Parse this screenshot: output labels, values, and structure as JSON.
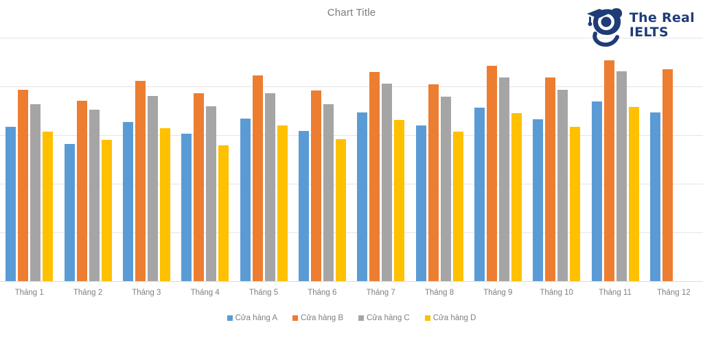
{
  "chart": {
    "title": "Chart Title"
  },
  "logo": {
    "mark_name": "graduation-cap-mascot-icon",
    "line1": "The Real",
    "line2": "IELTS",
    "color": "#1F3C77"
  },
  "legend": {
    "position": "bottom",
    "items": [
      {
        "label": "Cửa hàng A",
        "color": "#5B9BD5"
      },
      {
        "label": "Cửa hàng B",
        "color": "#ED7D31"
      },
      {
        "label": "Cửa hàng C",
        "color": "#A5A5A5"
      },
      {
        "label": "Cửa hàng D",
        "color": "#FFC000"
      }
    ]
  },
  "chart_data": {
    "type": "bar",
    "title": "Chart Title",
    "xlabel": "",
    "ylabel": "",
    "grid": true,
    "ylim": [
      0,
      5.27
    ],
    "gridline_values": [
      0,
      1,
      2,
      3,
      4,
      5
    ],
    "axis_labels_visible": false,
    "categories": [
      "Tháng 1",
      "Tháng 2",
      "Tháng 3",
      "Tháng 4",
      "Tháng 5",
      "Tháng 6",
      "Tháng 7",
      "Tháng 8",
      "Tháng 9",
      "Tháng 10",
      "Tháng 11",
      "Tháng 12"
    ],
    "last_category_clipped": true,
    "series": [
      {
        "name": "Cửa hàng A",
        "color": "#5B9BD5",
        "values": [
          3.17,
          2.82,
          3.27,
          3.03,
          3.34,
          3.08,
          3.46,
          3.2,
          3.56,
          3.32,
          3.69,
          3.46
        ]
      },
      {
        "name": "Cửa hàng B",
        "color": "#ED7D31",
        "values": [
          3.93,
          3.71,
          4.11,
          3.86,
          4.23,
          3.92,
          4.3,
          4.04,
          4.42,
          4.18,
          4.54,
          4.35
        ]
      },
      {
        "name": "Cửa hàng C",
        "color": "#A5A5A5",
        "values": [
          3.63,
          3.52,
          3.8,
          3.59,
          3.86,
          3.63,
          4.06,
          3.79,
          4.18,
          3.93,
          4.31,
          null
        ]
      },
      {
        "name": "Cửa hàng D",
        "color": "#FFC000",
        "values": [
          3.07,
          2.9,
          3.14,
          2.79,
          3.2,
          2.92,
          3.31,
          3.07,
          3.45,
          3.17,
          3.58,
          null
        ]
      }
    ]
  }
}
